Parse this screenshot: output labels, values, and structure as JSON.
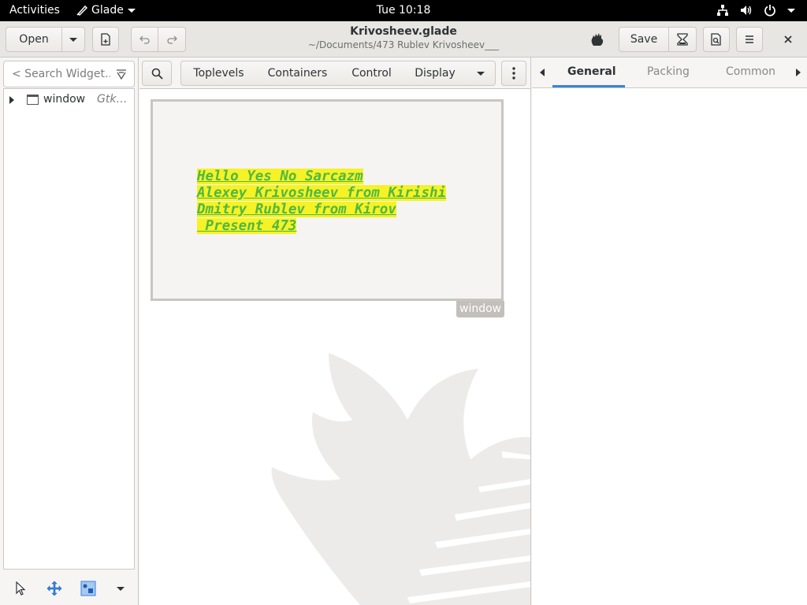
{
  "topbar": {
    "activities": "Activities",
    "app_name": "Glade",
    "clock": "Tue 10:18",
    "icons": [
      "network-icon",
      "volume-icon",
      "power-icon"
    ]
  },
  "headerbar": {
    "open_label": "Open",
    "save_label": "Save",
    "title": "Krivosheev.glade",
    "subtitle": "~/Documents/473 Rublev Krivosheev___"
  },
  "left_panel": {
    "search_placeholder": "< Search Widget…",
    "tree": [
      {
        "name": "window",
        "type": "Gtk…"
      }
    ]
  },
  "palette": {
    "groups": [
      "Toplevels",
      "Containers",
      "Control",
      "Display"
    ]
  },
  "design": {
    "window_label": "window",
    "label_lines": [
      "Hello Yes No Sarcazm",
      "Alexey Krivosheev from Kirishi",
      "Dmitry Rublev from Kirov",
      " Present 473"
    ]
  },
  "right_panel": {
    "tabs": [
      "General",
      "Packing",
      "Common"
    ],
    "active_tab": "General"
  },
  "colors": {
    "accent": "#3584e4",
    "label_text": "#4fb843",
    "label_highlight": "#f5f226"
  }
}
